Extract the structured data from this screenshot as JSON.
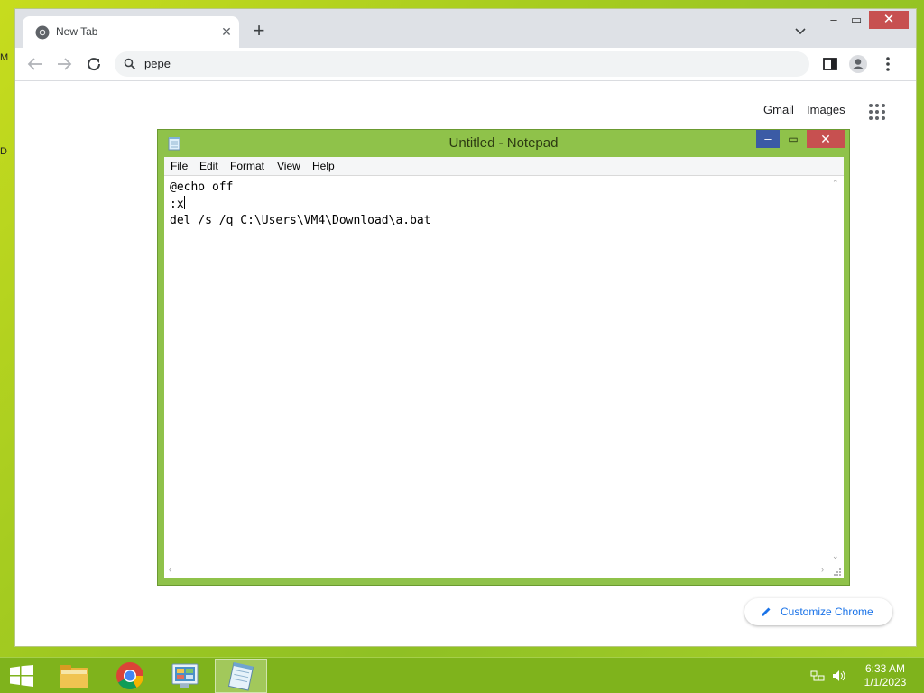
{
  "desktop": {
    "fragments": [
      "M",
      "D"
    ]
  },
  "chrome": {
    "tab": {
      "title": "New Tab"
    },
    "omnibox": {
      "value": "pepe"
    },
    "ntp": {
      "gmail": "Gmail",
      "images": "Images",
      "customize": "Customize Chrome"
    }
  },
  "notepad": {
    "title": "Untitled - Notepad",
    "menu": [
      "File",
      "Edit",
      "Format",
      "View",
      "Help"
    ],
    "lines": [
      "@echo off",
      ":x",
      "del /s /q C:\\Users\\VM4\\Download\\a.bat"
    ]
  },
  "taskbar": {
    "items": [
      "file-explorer",
      "chrome",
      "control-panel",
      "notepad"
    ],
    "active": "notepad",
    "clock": {
      "time": "6:33 AM",
      "date": "1/1/2023"
    }
  },
  "colors": {
    "desktop": "#a6cc20",
    "notepad_frame": "#8fc24a",
    "taskbar": "#7fb31c",
    "close": "#c75050",
    "minimize": "#3b5ba5",
    "link": "#1a73e8"
  }
}
